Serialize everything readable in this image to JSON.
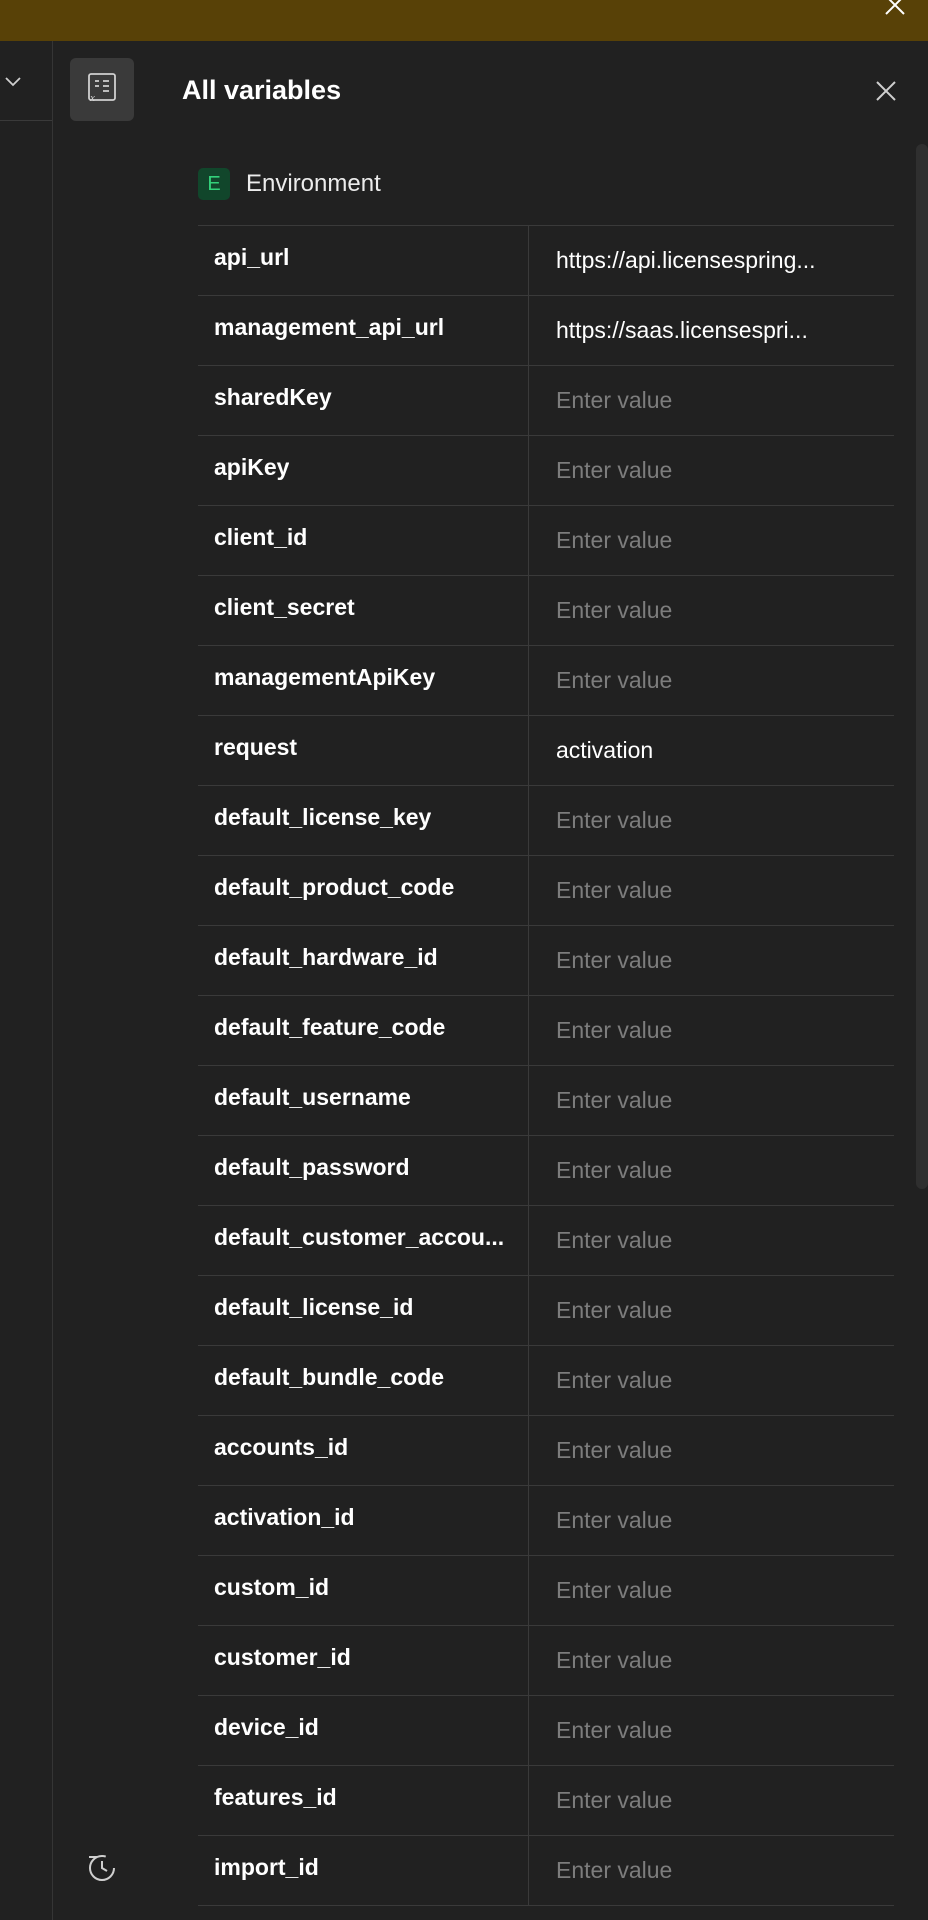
{
  "panel": {
    "title": "All variables",
    "section_badge": "E",
    "section_label": "Environment"
  },
  "variables": [
    {
      "key": "api_url",
      "value": "https://api.licensespring...",
      "is_placeholder": false
    },
    {
      "key": "management_api_url",
      "value": "https://saas.licensespri...",
      "is_placeholder": false
    },
    {
      "key": "sharedKey",
      "value": "Enter value",
      "is_placeholder": true
    },
    {
      "key": "apiKey",
      "value": "Enter value",
      "is_placeholder": true
    },
    {
      "key": "client_id",
      "value": "Enter value",
      "is_placeholder": true
    },
    {
      "key": "client_secret",
      "value": "Enter value",
      "is_placeholder": true
    },
    {
      "key": "managementApiKey",
      "value": "Enter value",
      "is_placeholder": true
    },
    {
      "key": "request",
      "value": "activation",
      "is_placeholder": false
    },
    {
      "key": "default_license_key",
      "value": "Enter value",
      "is_placeholder": true
    },
    {
      "key": "default_product_code",
      "value": "Enter value",
      "is_placeholder": true
    },
    {
      "key": "default_hardware_id",
      "value": "Enter value",
      "is_placeholder": true
    },
    {
      "key": "default_feature_code",
      "value": "Enter value",
      "is_placeholder": true
    },
    {
      "key": "default_username",
      "value": "Enter value",
      "is_placeholder": true
    },
    {
      "key": "default_password",
      "value": "Enter value",
      "is_placeholder": true
    },
    {
      "key": "default_customer_accou...",
      "value": "Enter value",
      "is_placeholder": true
    },
    {
      "key": "default_license_id",
      "value": "Enter value",
      "is_placeholder": true
    },
    {
      "key": "default_bundle_code",
      "value": "Enter value",
      "is_placeholder": true
    },
    {
      "key": "accounts_id",
      "value": "Enter value",
      "is_placeholder": true
    },
    {
      "key": "activation_id",
      "value": "Enter value",
      "is_placeholder": true
    },
    {
      "key": "custom_id",
      "value": "Enter value",
      "is_placeholder": true
    },
    {
      "key": "customer_id",
      "value": "Enter value",
      "is_placeholder": true
    },
    {
      "key": "device_id",
      "value": "Enter value",
      "is_placeholder": true
    },
    {
      "key": "features_id",
      "value": "Enter value",
      "is_placeholder": true
    },
    {
      "key": "import_id",
      "value": "Enter value",
      "is_placeholder": true
    }
  ],
  "icons": {
    "top_close": "close-icon",
    "left_chevron": "chevron-down-icon",
    "variables_tool": "variables-icon",
    "panel_close": "close-icon",
    "history": "history-icon"
  },
  "colors": {
    "top_bar": "#584107",
    "background": "#212121",
    "env_badge_bg": "#11462b",
    "env_badge_fg": "#33d17a",
    "placeholder": "#7d7d7d"
  }
}
